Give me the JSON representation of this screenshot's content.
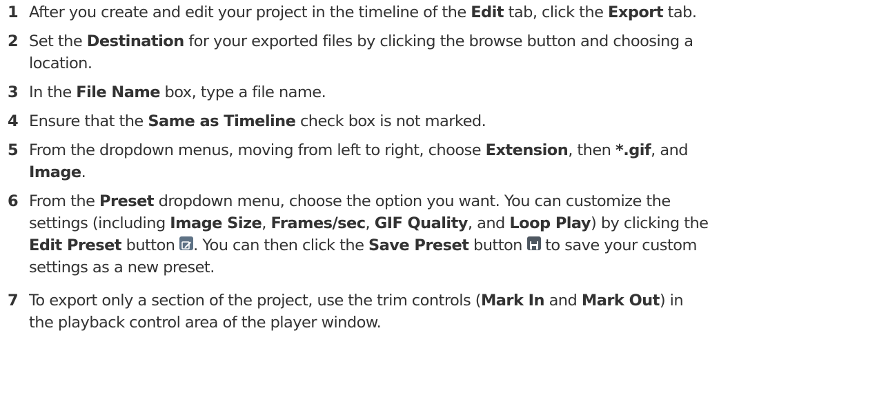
{
  "steps": [
    {
      "number": "1",
      "lines": [
        [
          "After you create and edit your project in the timeline of the ",
          {
            "b": "Edit"
          },
          " tab, click the ",
          {
            "b": "Export"
          },
          " tab."
        ]
      ]
    },
    {
      "number": "2",
      "lines": [
        [
          "Set the ",
          {
            "b": "Destination"
          },
          " for your exported files by clicking the browse button and choosing a"
        ],
        [
          "location."
        ]
      ]
    },
    {
      "number": "3",
      "lines": [
        [
          "In the ",
          {
            "b": "File Name"
          },
          " box, type a file name."
        ]
      ]
    },
    {
      "number": "4",
      "lines": [
        [
          "Ensure that the ",
          {
            "b": "Same as Timeline"
          },
          " check box is not marked."
        ]
      ]
    },
    {
      "number": "5",
      "lines": [
        [
          "From the dropdown menus, moving from left to right, choose ",
          {
            "b": "Extension"
          },
          ", then ",
          {
            "b": "*.gif"
          },
          ", and"
        ],
        [
          {
            "b": "Image"
          },
          "."
        ]
      ]
    },
    {
      "number": "6",
      "lines": [
        [
          "From the ",
          {
            "b": "Preset"
          },
          " dropdown menu, choose the option you want. You can customize the"
        ],
        [
          "settings (including ",
          {
            "b": "Image Size"
          },
          ", ",
          {
            "b": "Frames/sec"
          },
          ", ",
          {
            "b": "GIF Quality"
          },
          ", and ",
          {
            "b": "Loop Play"
          },
          ") by clicking the"
        ],
        [
          {
            "b": "Edit Preset"
          },
          " button ",
          {
            "icon": "edit-preset-icon"
          },
          ". You can then click the ",
          {
            "b": "Save Preset"
          },
          " button ",
          {
            "icon": "save-preset-icon"
          },
          " to save your custom"
        ],
        [
          "settings as a new preset."
        ]
      ]
    },
    {
      "number": "7",
      "lines": [
        [
          "To export only a section of the project, use the trim controls (",
          {
            "b": "Mark In"
          },
          " and ",
          {
            "b": "Mark Out"
          },
          ") in"
        ],
        [
          "the playback control area of the player window."
        ]
      ]
    }
  ]
}
